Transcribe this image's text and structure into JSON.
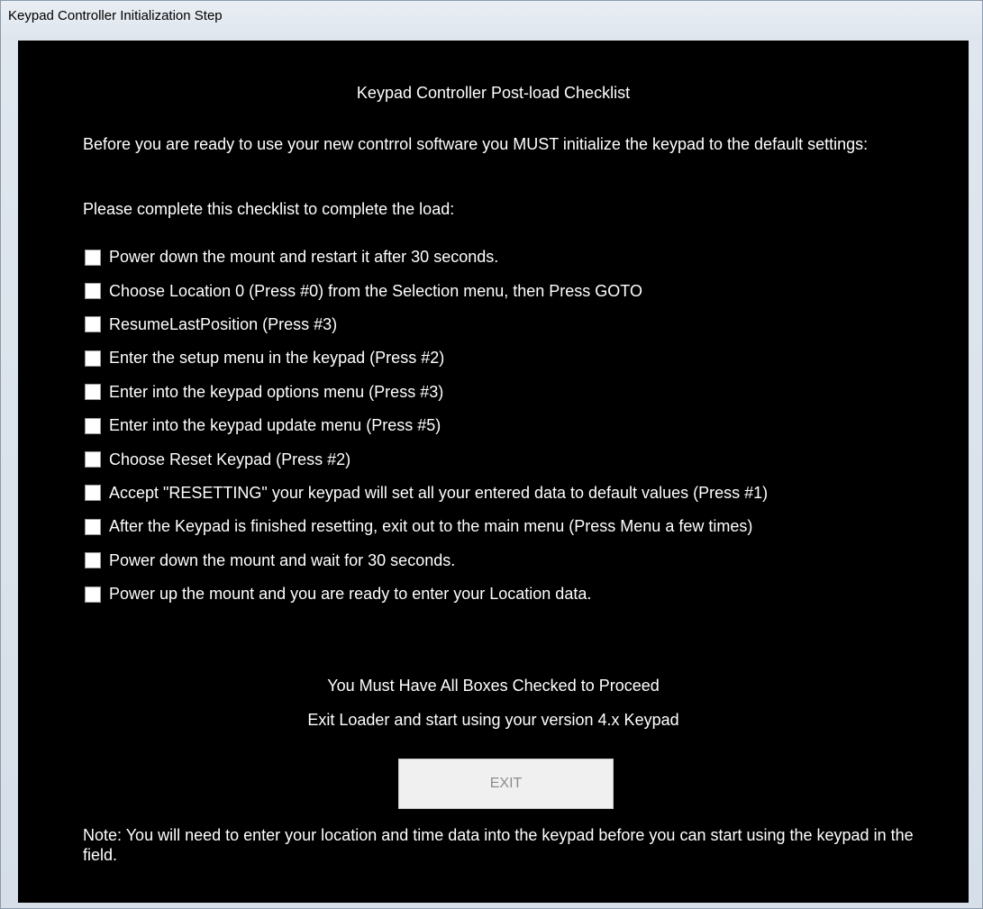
{
  "window": {
    "title": "Keypad Controller Initialization Step"
  },
  "dialog": {
    "heading": "Keypad Controller Post-load Checklist",
    "intro": "Before you are ready to use your new contrrol software you MUST initialize the keypad to the default settings:",
    "prompt": "Please complete this checklist to complete the load:",
    "checklist": [
      {
        "label": "Power down the mount and restart it after 30 seconds.",
        "checked": false
      },
      {
        "label": "Choose Location 0 (Press #0) from the Selection menu, then Press GOTO",
        "checked": false
      },
      {
        "label": "ResumeLastPosition (Press #3)",
        "checked": false
      },
      {
        "label": "Enter the setup menu in the keypad (Press #2)",
        "checked": false
      },
      {
        "label": "Enter into the keypad options menu (Press #3)",
        "checked": false
      },
      {
        "label": "Enter into the keypad update menu (Press #5)",
        "checked": false
      },
      {
        "label": "Choose Reset Keypad (Press #2)",
        "checked": false
      },
      {
        "label": "Accept \"RESETTING\" your keypad will set all your entered data to default values (Press #1)",
        "checked": false
      },
      {
        "label": "After the Keypad is finished resetting, exit out to the main menu (Press Menu a few times)",
        "checked": false
      },
      {
        "label": "Power down the mount and wait for 30 seconds.",
        "checked": false
      },
      {
        "label": "Power up the mount and you are ready to enter your Location data.",
        "checked": false
      }
    ],
    "requirement": "You Must Have All Boxes Checked to Proceed",
    "exit_hint": "Exit Loader and start using your version 4.x Keypad",
    "exit_label": "EXIT",
    "note": "Note: You will need to enter your location and time data into the keypad before you can start using the keypad in the field."
  }
}
